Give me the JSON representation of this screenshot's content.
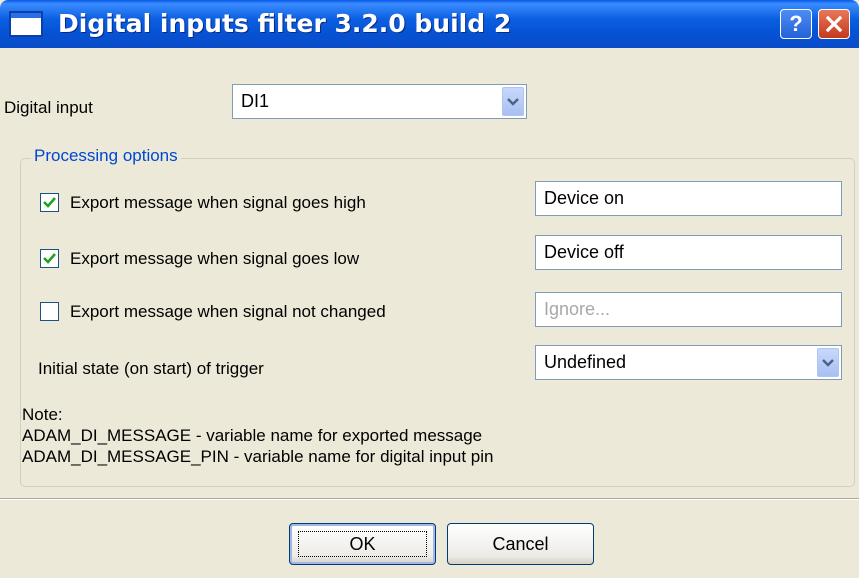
{
  "window": {
    "title": "Digital inputs filter 3.2.0 build 2",
    "help_label": "?",
    "icons": {
      "app": "window-icon",
      "help": "help-icon",
      "close": "close-icon"
    }
  },
  "digital_input": {
    "label": "Digital input",
    "value": "DI1"
  },
  "processing": {
    "legend": "Processing options",
    "rows": [
      {
        "label": "Export message when signal goes high",
        "checked": true,
        "value": "Device on",
        "placeholder": ""
      },
      {
        "label": "Export message when signal goes low",
        "checked": true,
        "value": "Device off",
        "placeholder": ""
      },
      {
        "label": "Export message when signal not changed",
        "checked": false,
        "value": "",
        "placeholder": "Ignore..."
      }
    ],
    "initial_state": {
      "label": "Initial state (on start) of trigger",
      "value": "Undefined"
    },
    "note": {
      "heading": "Note:",
      "lines": [
        "ADAM_DI_MESSAGE - variable name for exported message",
        "ADAM_DI_MESSAGE_PIN - variable name for digital input pin"
      ]
    }
  },
  "buttons": {
    "ok": "OK",
    "cancel": "Cancel"
  },
  "colors": {
    "titlebar": "#0552d4",
    "legend": "#0046d5",
    "checkmark": "#21a121",
    "dialog_bg": "#ece9d8"
  }
}
